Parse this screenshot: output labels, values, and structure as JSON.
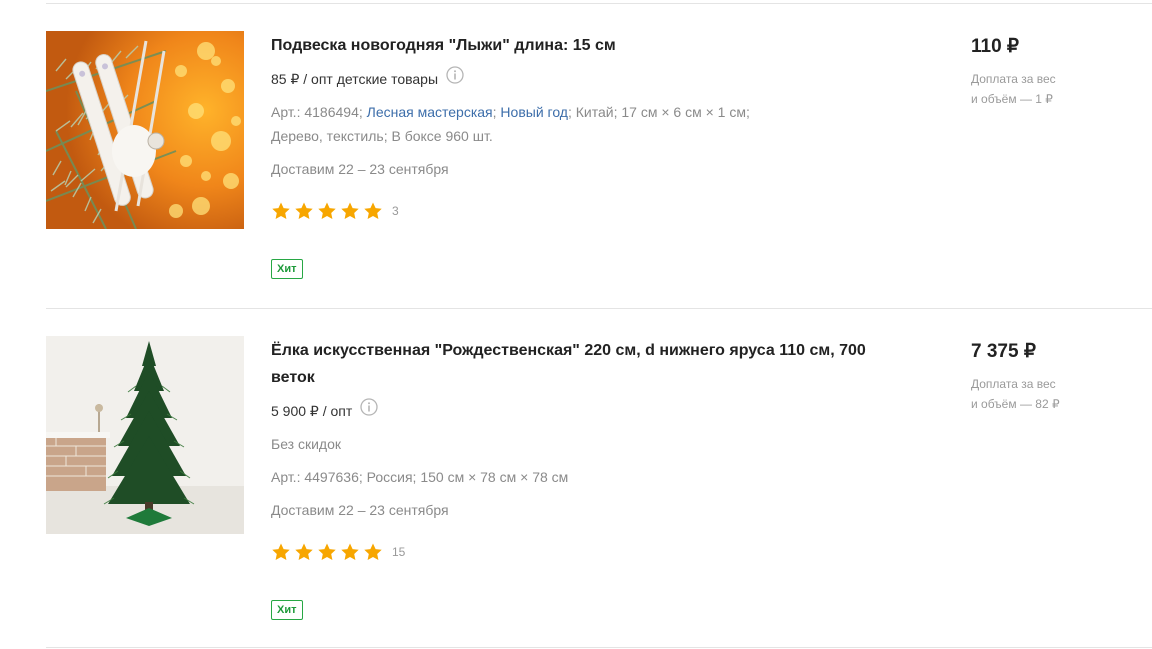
{
  "products": [
    {
      "title": "Подвеска новогодняя \"Лыжи\" длина: 15 см",
      "wholesale_price": "85 ₽ / опт детские товары",
      "article": "Арт.: 4186494;",
      "brand": "Лесная мастерская",
      "sep1": ";",
      "collection": "Новый год",
      "sep2": ";",
      "specs_rest": "Китай;  17 см × 6 см × 1 см;",
      "specs_line2": "Дерево, текстиль;  В боксе 960 шт.",
      "delivery": "Доставим 22 – 23 сентября",
      "rating": 5,
      "rating_count": "3",
      "badge": "Хит",
      "price": "110 ₽",
      "surcharge_line1": "Доплата за вес",
      "surcharge_line2": "и объём — 1 ₽"
    },
    {
      "title": "Ёлка искусственная \"Рождественская\" 220 см, d нижнего яруса 110 см, 700 веток",
      "wholesale_price": "5 900 ₽ / опт",
      "discount_note": "Без скидок",
      "specs": "Арт.: 4497636; Россия;  150 см × 78 см × 78 см",
      "delivery": "Доставим 22 – 23 сентября",
      "rating": 5,
      "rating_count": "15",
      "badge": "Хит",
      "price": "7 375 ₽",
      "surcharge_line1": "Доплата за вес",
      "surcharge_line2": "и объём — 82 ₽"
    }
  ],
  "colors": {
    "star": "#f7a600",
    "badge": "#27a744",
    "link": "#3d6eaa",
    "divider": "#e4e4e4"
  },
  "icons": [
    "info-icon",
    "star-icon"
  ]
}
